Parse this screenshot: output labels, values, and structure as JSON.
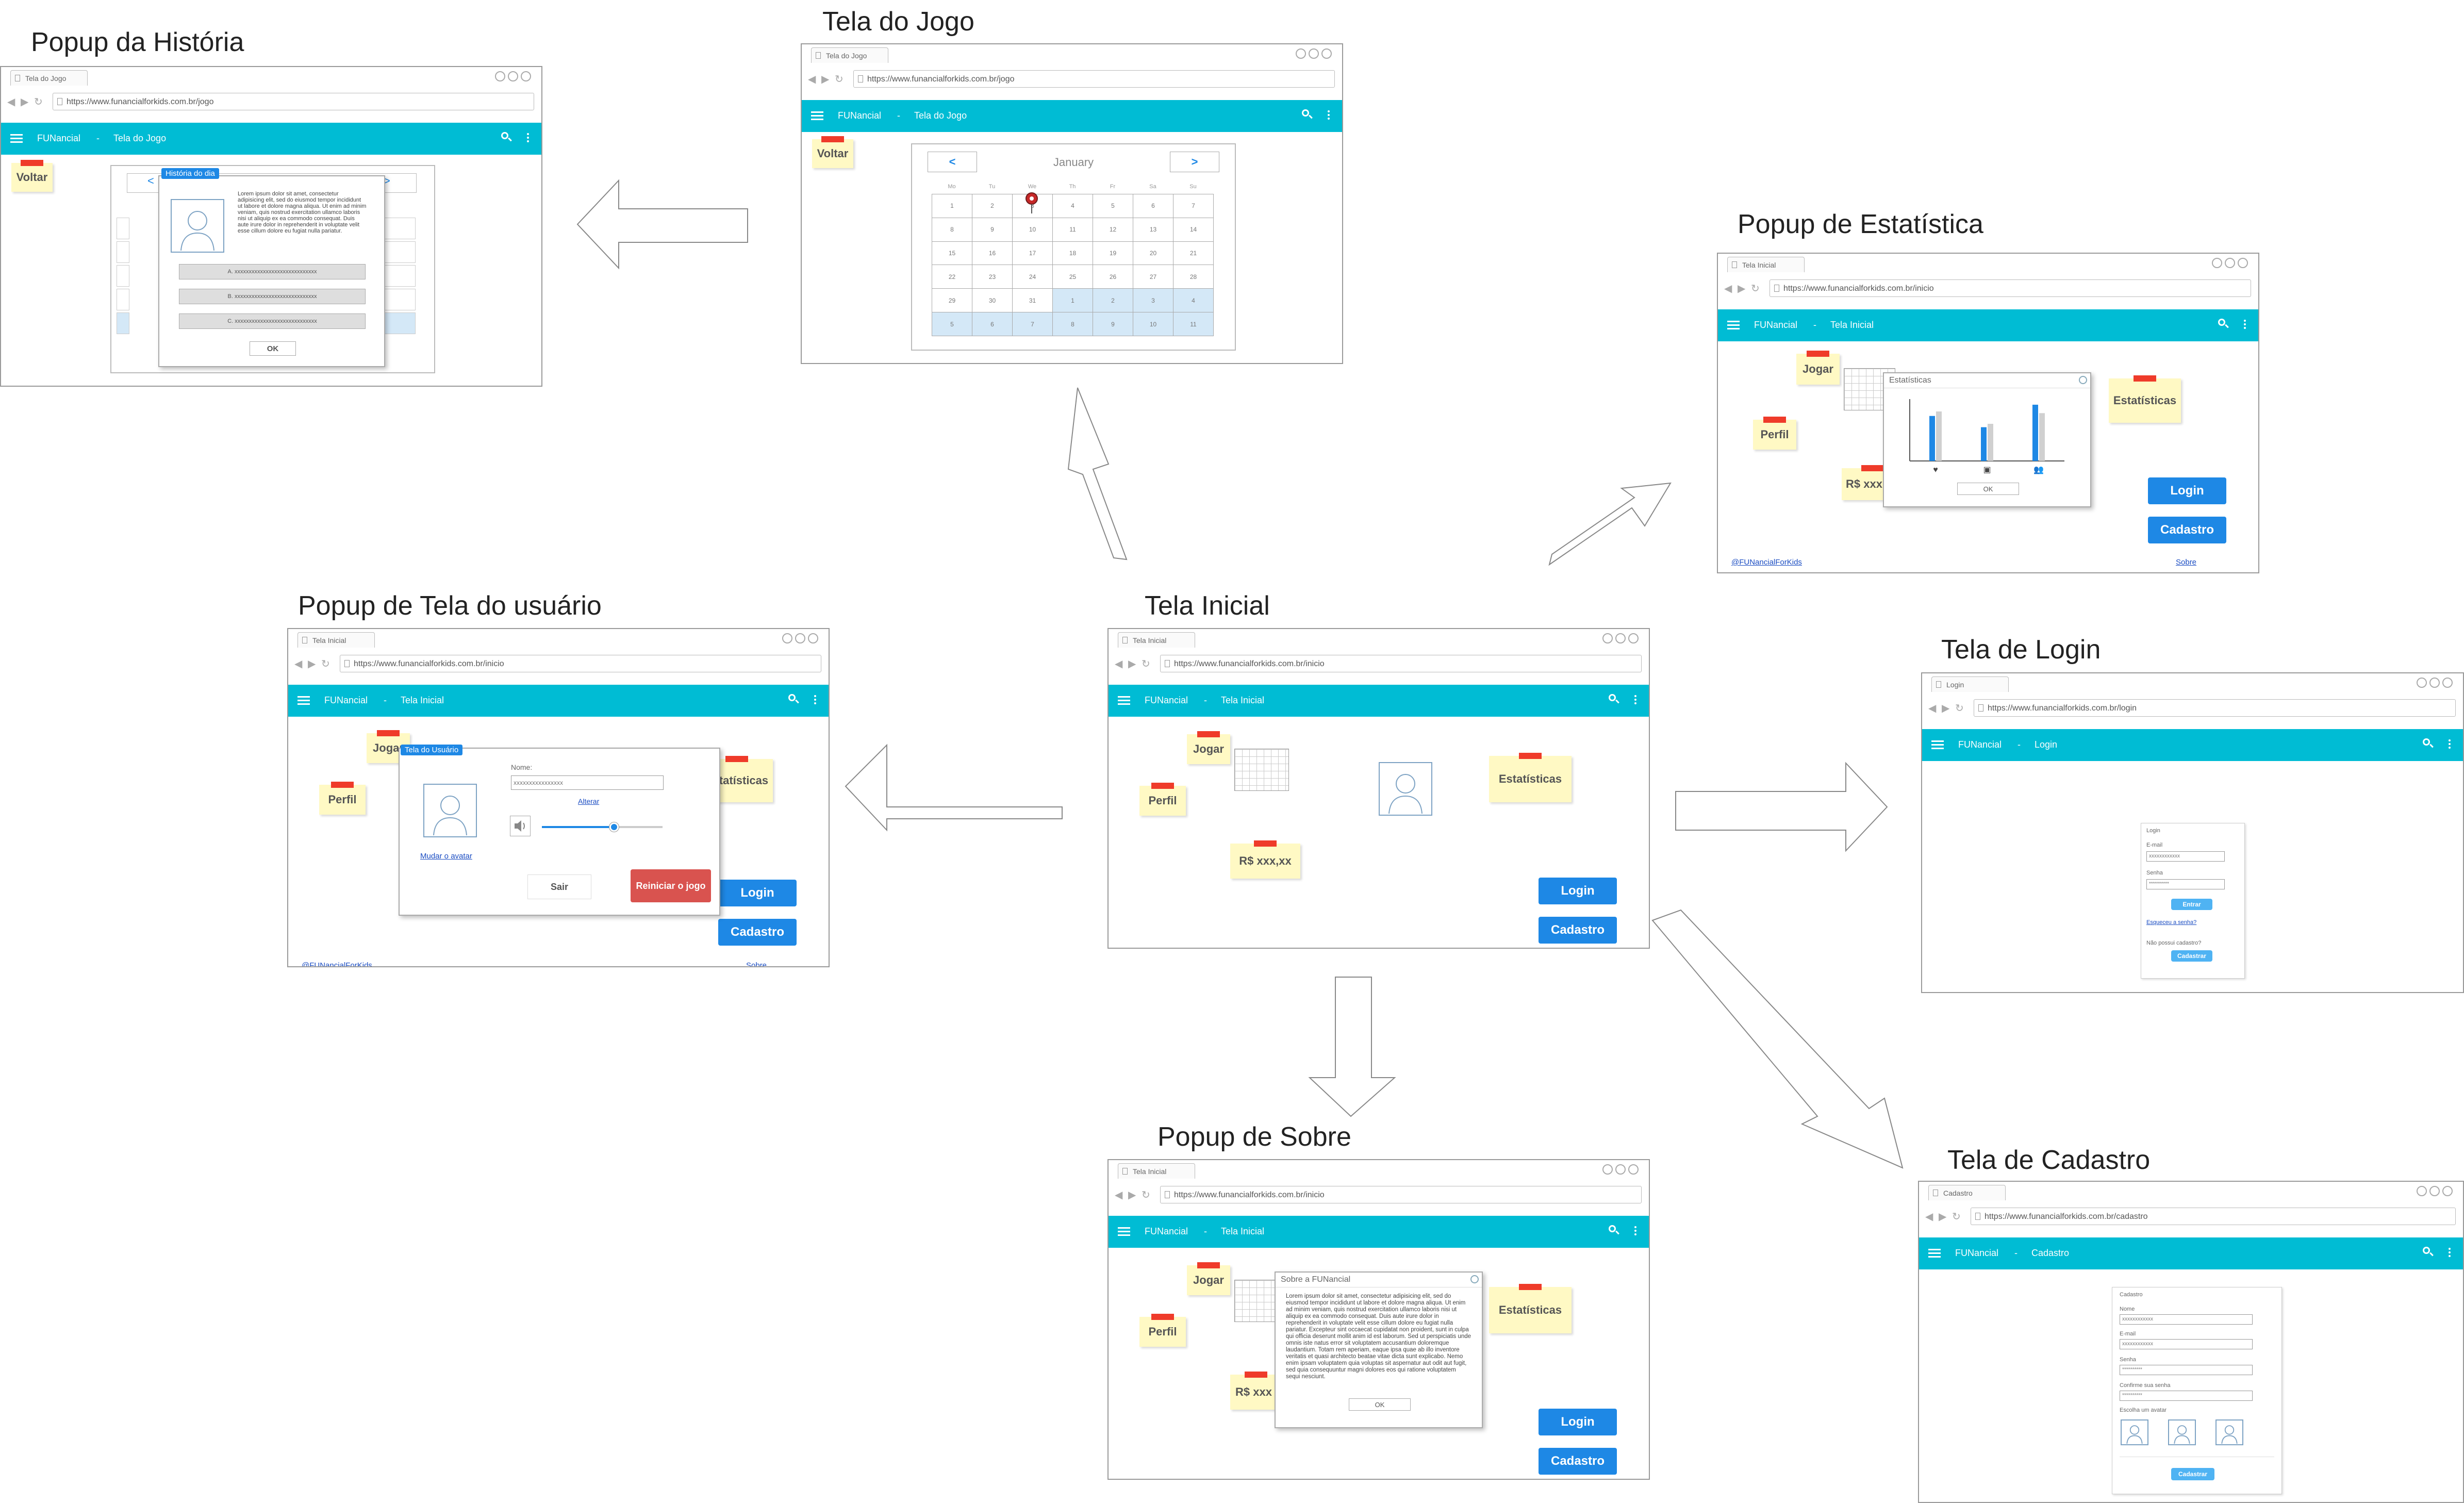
{
  "titles": {
    "historia": "Popup da História",
    "jogo": "Tela do Jogo",
    "estatistica": "Popup de Estatística",
    "usuario": "Popup de Tela do usuário",
    "inicial": "Tela Inicial",
    "login": "Tela de Login",
    "sobre": "Popup de Sobre",
    "cadastro": "Tela de Cadastro"
  },
  "common": {
    "brand": "FUNancial",
    "sep": "-",
    "jogar": "Jogar",
    "perfil": "Perfil",
    "estatisticas": "Estatísticas",
    "saldo": "R$ xxx,xx",
    "saldo_cut": "R$ xxx",
    "login": "Login",
    "cadastro": "Cadastro",
    "twitter": "@FUNancialForKids",
    "sobre": "Sobre",
    "voltar": "Voltar",
    "ok": "OK",
    "tab_inicial": "Tela Inicial",
    "page_inicial": "Tela Inicial",
    "url_inicio": "https://www.funancialforkids.com.br/inicio"
  },
  "jogo": {
    "tab": "Tela do Jogo",
    "url": "https://www.funancialforkids.com.br/jogo",
    "page": "Tela do Jogo",
    "month": "January",
    "prev": "<",
    "next": ">",
    "weekdays": [
      "Mo",
      "Tu",
      "We",
      "Th",
      "Fr",
      "Sa",
      "Su"
    ],
    "days": [
      "1",
      "2",
      "3",
      "4",
      "5",
      "6",
      "7",
      "8",
      "9",
      "10",
      "11",
      "12",
      "13",
      "14",
      "15",
      "16",
      "17",
      "18",
      "19",
      "20",
      "21",
      "22",
      "23",
      "24",
      "25",
      "26",
      "27",
      "28",
      "29",
      "30",
      "31",
      "1",
      "2",
      "3",
      "4",
      "5",
      "6",
      "7",
      "8",
      "9",
      "10",
      "11"
    ]
  },
  "historia": {
    "label": "História do dia",
    "text": "Lorem ipsum dolor sit amet, consectetur adipisicing elit, sed do eiusmod tempor incididunt ut labore et dolore magna aliqua. Ut enim ad minim veniam, quis nostrud exercitation ullamco laboris nisi ut aliquip ex ea commodo consequat. Duis aute irure dolor in reprehenderit in voluptate velit esse cillum dolore eu fugiat nulla pariatur.",
    "a": "A. xxxxxxxxxxxxxxxxxxxxxxxxxxxxx",
    "b": "B. xxxxxxxxxxxxxxxxxxxxxxxxxxxxx",
    "c": "C. xxxxxxxxxxxxxxxxxxxxxxxxxxxxx"
  },
  "estat": {
    "popup_title": "Estatísticas",
    "chart_data": {
      "type": "bar",
      "categories": [
        "heart",
        "money",
        "people"
      ],
      "series": [
        {
          "values": [
            80,
            60,
            100
          ],
          "color": "#1e88e5"
        },
        {
          "values": [
            88,
            66,
            85
          ],
          "color": "#d0d0d0"
        }
      ],
      "ylim": [
        0,
        110
      ]
    }
  },
  "usuario": {
    "label": "Tela do Usuário",
    "nome_label": "Nome:",
    "nome_value": "xxxxxxxxxxxxxxxx",
    "alterar": "Alterar",
    "mudar": "Mudar o avatar",
    "sair": "Sair",
    "reiniciar": "Reiniciar o jogo",
    "volume": 0.6
  },
  "loginpage": {
    "tab": "Login",
    "url": "https://www.funancialforkids.com.br/login",
    "page": "Login",
    "form_title": "Login",
    "email": "E-mail",
    "email_val": "xxxxxxxxxxxx",
    "senha": "Senha",
    "senha_val": "**********",
    "entrar": "Entrar",
    "esqueceu": "Esqueceu a senha?",
    "nao_possui": "Não possui cadastro?",
    "cadastrar": "Cadastrar"
  },
  "sobre": {
    "popup_title": "Sobre a FUNancial",
    "text": "Lorem ipsum dolor sit amet, consectetur adipisicing elit, sed do eiusmod tempor incididunt ut labore et dolore magna aliqua. Ut enim ad minim veniam, quis nostrud exercitation ullamco laboris nisi ut aliquip ex ea commodo consequat. Duis aute irure dolor in reprehenderit in voluptate velit esse cillum dolore eu fugiat nulla pariatur. Excepteur sint occaecat cupidatat non proident, sunt in culpa qui officia deserunt mollit anim id est laborum. Sed ut perspiciatis unde omnis iste natus error sit voluptatem accusantium doloremque laudantium. Totam rem aperiam, eaque ipsa quae ab illo inventore veritatis et quasi architecto beatae vitae dicta sunt explicabo. Nemo enim ipsam voluptatem quia voluptas sit aspernatur aut odit aut fugit, sed quia consequuntur magni dolores eos qui ratione voluptatem sequi nesciunt."
  },
  "cadpage": {
    "tab": "Cadastro",
    "url": "https://www.funancialforkids.com.br/cadastro",
    "page": "Cadastro",
    "form_title": "Cadastro",
    "nome": "Nome",
    "nome_val": "xxxxxxxxxxxx",
    "email": "E-mail",
    "email_val": "xxxxxxxxxxxx",
    "senha": "Senha",
    "senha_val": "**********",
    "confirme": "Confirme sua senha",
    "confirme_val": "**********",
    "escolha": "Escolha um avatar",
    "cadastrar": "Cadastrar"
  }
}
